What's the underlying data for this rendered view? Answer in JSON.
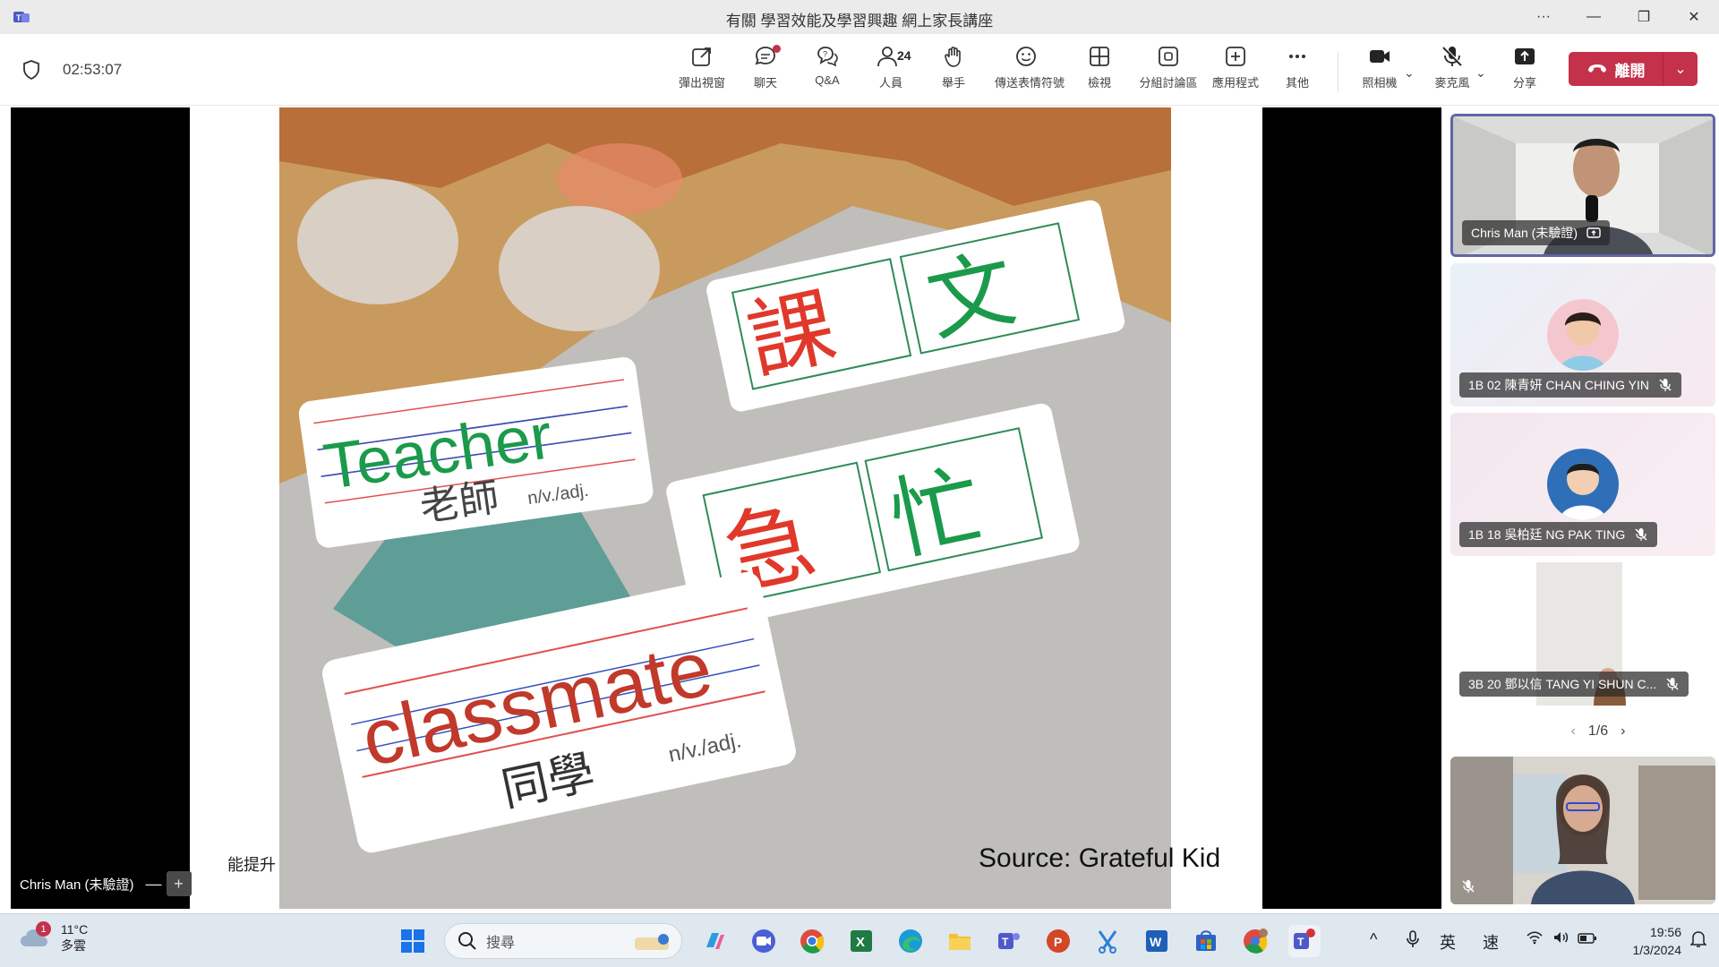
{
  "window": {
    "title": "有關 學習效能及學習興趣 網上家長講座",
    "controls": [
      "more-icon",
      "minimize-icon",
      "restore-icon",
      "close-icon"
    ],
    "controls_glyphs": [
      "···",
      "—",
      "❐",
      "✕"
    ]
  },
  "meeting": {
    "timer": "02:53:07",
    "toolbar": [
      {
        "id": "popout",
        "label": "彈出視窗",
        "icon": "popout-icon"
      },
      {
        "id": "chat",
        "label": "聊天",
        "icon": "chat-icon",
        "has_notification": true
      },
      {
        "id": "qa",
        "label": "Q&A",
        "icon": "qa-icon"
      },
      {
        "id": "people",
        "label": "人員",
        "icon": "people-icon",
        "count": "24"
      },
      {
        "id": "raise",
        "label": "舉手",
        "icon": "raise-hand-icon"
      },
      {
        "id": "react",
        "label": "傳送表情符號",
        "icon": "emoji-icon"
      },
      {
        "id": "view",
        "label": "檢視",
        "icon": "view-grid-icon"
      },
      {
        "id": "rooms",
        "label": "分組討論區",
        "icon": "breakout-rooms-icon"
      },
      {
        "id": "apps",
        "label": "應用程式",
        "icon": "apps-icon"
      },
      {
        "id": "more",
        "label": "其他",
        "icon": "more-icon"
      },
      {
        "id": "camera",
        "label": "照相機",
        "icon": "camera-icon"
      },
      {
        "id": "mic",
        "label": "麥克風",
        "icon": "mic-off-icon"
      },
      {
        "id": "share",
        "label": "分享",
        "icon": "share-icon"
      }
    ],
    "leave_label": "離開",
    "accent": "#6264a7",
    "leave_color": "#c4314b"
  },
  "stage": {
    "slide_caption": "能提升",
    "source_text": "Source: Grateful Kid",
    "presenter_name": "Chris Man (未驗證)",
    "cards": {
      "card1_chars": [
        "課",
        "文"
      ],
      "card2_word": "Teacher",
      "card2_meaning": "老師",
      "card2_pos": "n/v./adj.",
      "card3_chars": [
        "急",
        "忙"
      ],
      "card4_word": "classmate",
      "card4_meaning": "同學",
      "card4_pos": "n/v./adj."
    }
  },
  "participants": [
    {
      "name": "Chris Man (未驗證)",
      "active": true
    },
    {
      "name": "1B 02 陳青妍 CHAN CHING YIN",
      "muted": true
    },
    {
      "name": "1B 18 吳柏廷 NG PAK TING",
      "muted": true
    },
    {
      "name": "3B 20 鄧以信 TANG YI SHUN C...",
      "muted": true
    },
    {
      "name": "",
      "muted": true,
      "self": true
    }
  ],
  "pager": {
    "text": "1/6"
  },
  "taskbar": {
    "weather_badge": "1",
    "temperature": "11°C",
    "condition": "多雲",
    "search_placeholder": "搜尋",
    "tray_ime_1": "英",
    "tray_ime_2": "速",
    "time": "19:56",
    "date": "1/3/2024",
    "pinned_apps": [
      "windows-start-icon",
      "copilot-icon",
      "zoom-icon",
      "chrome-icon",
      "excel-icon",
      "edge-icon",
      "file-explorer-icon",
      "teams-icon",
      "powerpoint-icon",
      "snipping-tool-icon",
      "word-icon",
      "store-icon",
      "chrome-profile-icon",
      "teams-new-icon"
    ]
  }
}
